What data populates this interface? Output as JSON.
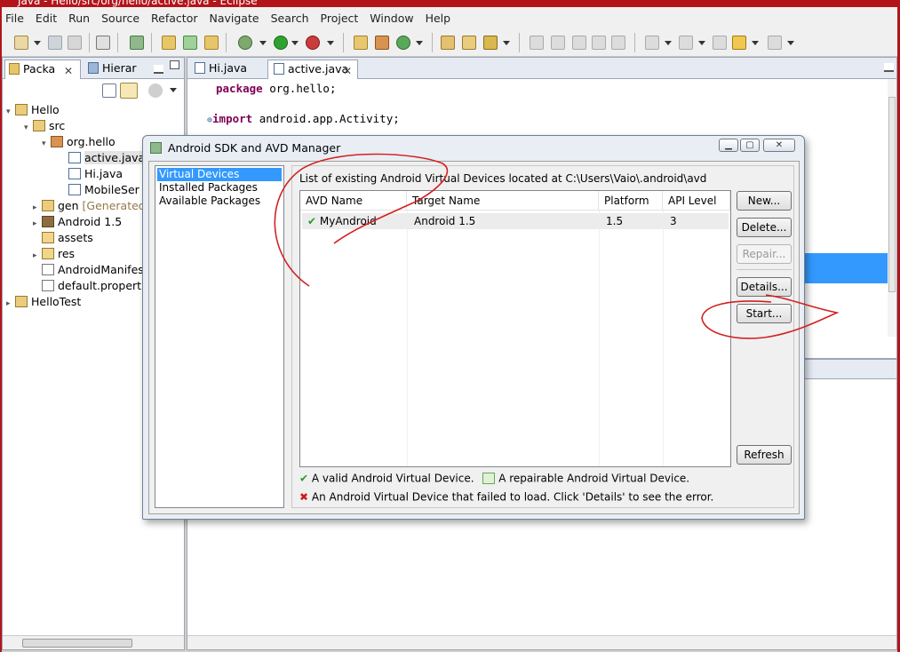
{
  "window": {
    "title": "Java - Hello/src/org/hello/active.java - Eclipse"
  },
  "menubar": [
    "File",
    "Edit",
    "Run",
    "Source",
    "Refactor",
    "Navigate",
    "Search",
    "Project",
    "Window",
    "Help"
  ],
  "left_pane": {
    "tabs": [
      {
        "label": "Packa"
      },
      {
        "label": "Hierar"
      }
    ],
    "tree": [
      {
        "label": "Hello",
        "icon": "project-icon"
      },
      {
        "label": "src",
        "icon": "source-folder-icon"
      },
      {
        "label": "org.hello",
        "icon": "package-icon"
      },
      {
        "label": "active.java",
        "icon": "java-file-icon"
      },
      {
        "label": "Hi.java",
        "icon": "java-file-icon"
      },
      {
        "label": "MobileSer",
        "icon": "java-file-icon"
      },
      {
        "label": "gen",
        "decoration": "[Generated Ja",
        "icon": "source-folder-icon"
      },
      {
        "label": "Android 1.5",
        "icon": "library-icon"
      },
      {
        "label": "assets",
        "icon": "folder-icon"
      },
      {
        "label": "res",
        "icon": "folder-icon"
      },
      {
        "label": "AndroidManifest.",
        "icon": "xml-file-icon"
      },
      {
        "label": "default.properties",
        "icon": "file-icon"
      },
      {
        "label": "HelloTest",
        "icon": "project-icon"
      }
    ]
  },
  "editor": {
    "tabs": [
      {
        "label": "Hi.java"
      },
      {
        "label": "active.java"
      }
    ],
    "code": {
      "line1_kw": "package",
      "line1_rest": " org.hello;",
      "line2_kw": "import",
      "line2_rest": " android.app.Activity;"
    }
  },
  "dialog": {
    "title": "Android SDK and AVD Manager",
    "nav": [
      "Virtual Devices",
      "Installed Packages",
      "Available Packages"
    ],
    "caption": "List of existing Android Virtual Devices located at C:\\Users\\Vaio\\.android\\avd",
    "columns": [
      "AVD Name",
      "Target Name",
      "Platform",
      "API Level"
    ],
    "rows": [
      {
        "name": "MyAndroid",
        "target": "Android 1.5",
        "platform": "1.5",
        "api": "3"
      }
    ],
    "buttons": {
      "new": "New...",
      "delete": "Delete...",
      "repair": "Repair...",
      "details": "Details...",
      "start": "Start...",
      "refresh": "Refresh"
    },
    "legend": {
      "valid": "A valid Android Virtual Device.",
      "repairable": "A repairable Android Virtual Device.",
      "failed": "An Android Virtual Device that failed to load. Click 'Details' to see the error."
    }
  },
  "colors": {
    "selection": "#3399ff",
    "annotation": "#d42020",
    "window_frame": "#b3141a"
  }
}
